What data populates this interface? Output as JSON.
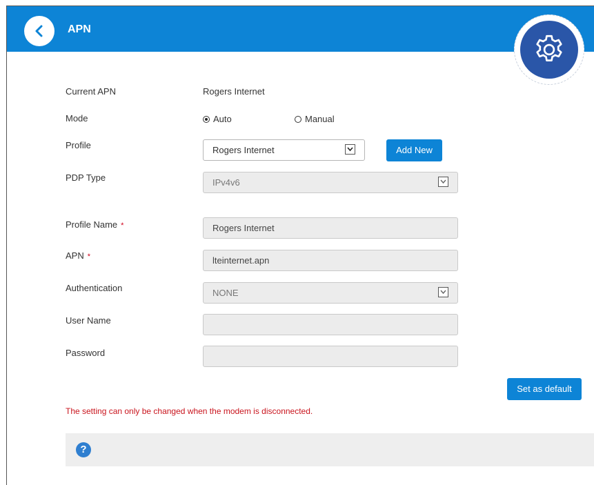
{
  "header": {
    "title": "APN",
    "back_icon": "chevron-left-icon",
    "settings_icon": "gear-icon"
  },
  "form": {
    "current_apn": {
      "label": "Current APN",
      "value": "Rogers Internet"
    },
    "mode": {
      "label": "Mode",
      "auto_label": "Auto",
      "manual_label": "Manual",
      "selected": "Auto"
    },
    "profile": {
      "label": "Profile",
      "value": "Rogers Internet",
      "add_new_label": "Add New"
    },
    "pdp_type": {
      "label": "PDP Type",
      "value": "IPv4v6"
    },
    "profile_name": {
      "label": "Profile Name",
      "required_mark": "*",
      "value": "Rogers Internet"
    },
    "apn": {
      "label": "APN",
      "required_mark": "*",
      "value": "lteinternet.apn"
    },
    "authentication": {
      "label": "Authentication",
      "value": "NONE"
    },
    "user_name": {
      "label": "User Name",
      "value": ""
    },
    "password": {
      "label": "Password",
      "value": ""
    }
  },
  "actions": {
    "set_default_label": "Set as default"
  },
  "warning": "The setting can only be changed when the modem is disconnected.",
  "help": {
    "icon_glyph": "?"
  },
  "colors": {
    "header_blue": "#0d84d6",
    "gear_blue": "#2a56a8",
    "warning_red": "#c9141d",
    "required_red": "#d0021b"
  }
}
